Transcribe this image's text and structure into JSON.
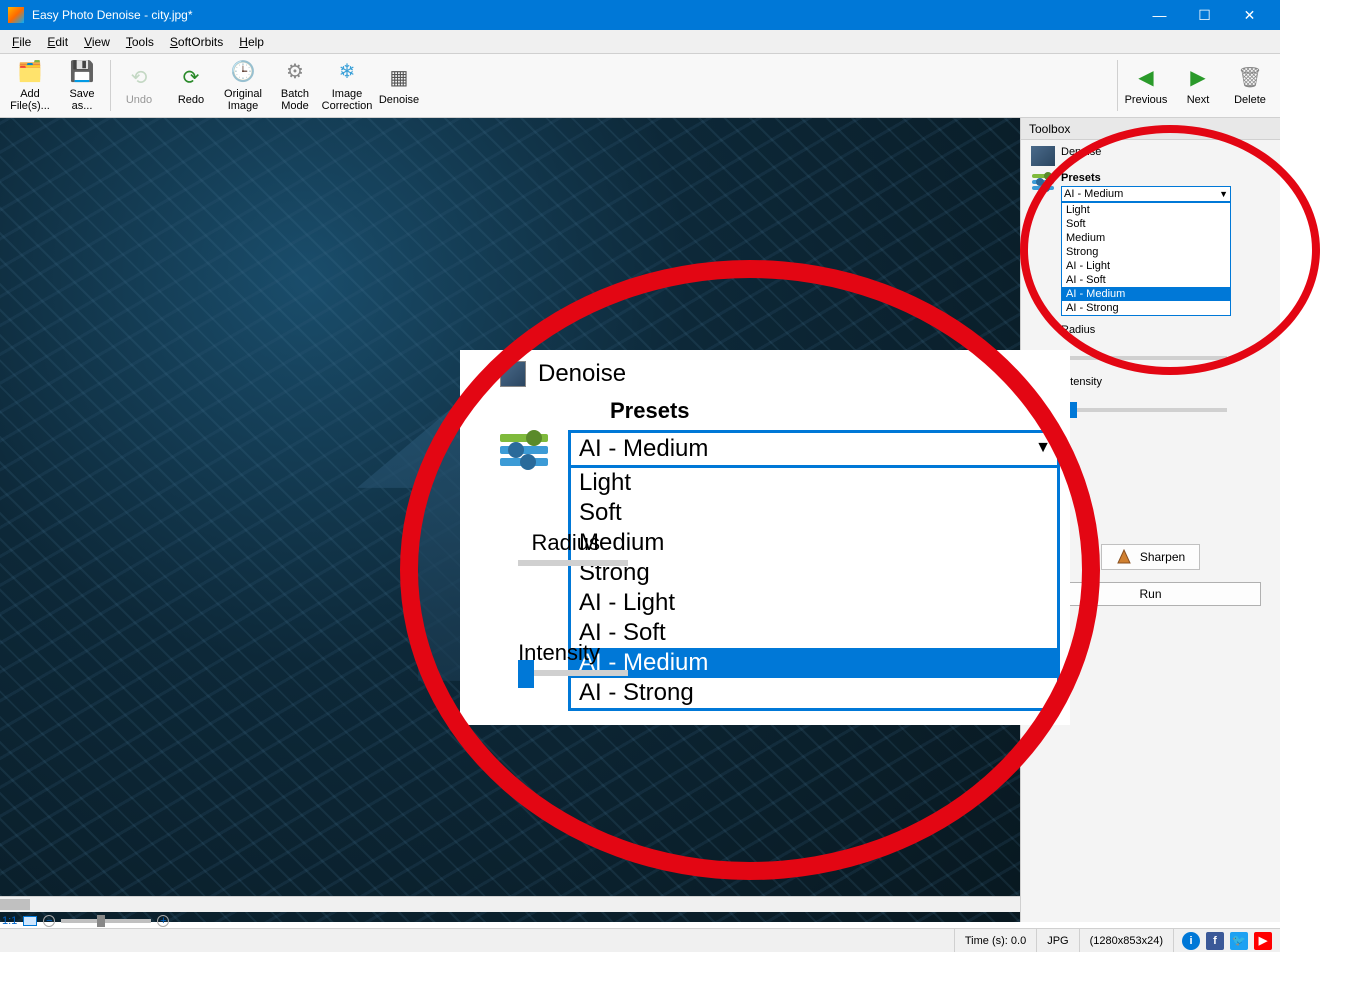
{
  "title": "Easy Photo Denoise - city.jpg*",
  "menu": {
    "file": "File",
    "edit": "Edit",
    "view": "View",
    "tools": "Tools",
    "softorbits": "SoftOrbits",
    "help": "Help"
  },
  "toolbar": {
    "add_files": "Add File(s)...",
    "save_as": "Save as...",
    "undo": "Undo",
    "redo": "Redo",
    "original": "Original Image",
    "batch": "Batch Mode",
    "correction": "Image Correction",
    "denoise": "Denoise",
    "previous": "Previous",
    "next": "Next",
    "delete": "Delete"
  },
  "toolbox": {
    "header": "Toolbox",
    "section_denoise": "Denoise",
    "presets_label": "Presets",
    "presets_selected": "AI - Medium",
    "presets_options": [
      "Light",
      "Soft",
      "Medium",
      "Strong",
      "AI - Light",
      "AI - Soft",
      "AI - Medium",
      "AI - Strong"
    ],
    "radius_label": "Radius",
    "intensity_label": "Intensity",
    "sharpen_btn": "Sharpen",
    "run_btn": "Run"
  },
  "zoom": {
    "ratio": "1:1",
    "minus": "−",
    "plus": "+"
  },
  "status": {
    "time": "Time (s): 0.0",
    "format": "JPG",
    "dims": "(1280x853x24)"
  },
  "social": {
    "info": "i",
    "fb": "f",
    "tw": "t",
    "yt": "▶"
  }
}
